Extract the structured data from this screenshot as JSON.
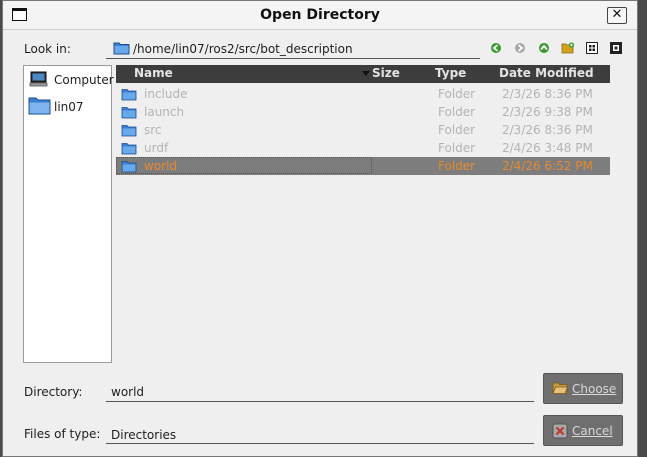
{
  "window": {
    "title": "Open Directory"
  },
  "lookin": {
    "label": "Look in:",
    "path": "/home/lin07/ros2/src/bot_description"
  },
  "toolbar": {
    "icons": [
      "back-icon",
      "forward-icon",
      "parent-directory-icon",
      "new-folder-icon",
      "list-view-icon",
      "detail-view-icon"
    ]
  },
  "sidebar": {
    "items": [
      {
        "label": "Computer",
        "icon": "computer-icon"
      },
      {
        "label": "lin07",
        "icon": "folder-icon"
      }
    ]
  },
  "table": {
    "headers": [
      "Name",
      "Size",
      "Type",
      "Date Modified"
    ],
    "rows": [
      {
        "name": "include",
        "size": "",
        "type": "Folder",
        "modified": "2/3/26 8:36 PM"
      },
      {
        "name": "launch",
        "size": "",
        "type": "Folder",
        "modified": "2/3/26 9:38 PM"
      },
      {
        "name": "src",
        "size": "",
        "type": "Folder",
        "modified": "2/3/26 8:36 PM"
      },
      {
        "name": "urdf",
        "size": "",
        "type": "Folder",
        "modified": "2/4/26 3:48 PM"
      },
      {
        "name": "world",
        "size": "",
        "type": "Folder",
        "modified": "2/4/26 6:52 PM"
      }
    ],
    "selected": "world"
  },
  "directory": {
    "label": "Directory:",
    "value": "world"
  },
  "filetype": {
    "label": "Files of type:",
    "value": "Directories"
  },
  "buttons": {
    "choose": "Choose",
    "cancel": "Cancel"
  },
  "colors": {
    "selection_text": "#e68a2e",
    "header_bg": "#3d3d3d",
    "folder_blue": "#3c7fd1"
  }
}
